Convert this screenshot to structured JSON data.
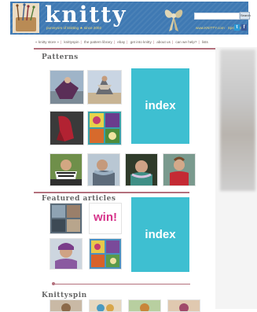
{
  "header": {
    "logo_text": "knitty",
    "tagline": "purveyors of knitting ★ since 2002",
    "search_button": "Search",
    "promo": "www.KNITTY.com · Spring 2014",
    "social_twitter": "t",
    "social_facebook": "f"
  },
  "nav": {
    "items": [
      "« knitty store »",
      "knittyspin",
      "the pattern library",
      "ebay",
      "get into knitty",
      "about us",
      "can we help?",
      "lists"
    ]
  },
  "patterns": {
    "title": "Patterns",
    "captions": [
      "",
      "",
      "",
      "",
      "",
      "",
      "",
      ""
    ],
    "index_label": "index"
  },
  "featured": {
    "title": "Featured articles",
    "win_label": "win!",
    "index_label": "index",
    "captions": [
      "",
      "",
      "",
      ""
    ]
  },
  "knittyspin": {
    "title": "Knittyspin"
  },
  "colors": {
    "header_blue": "#3f79b3",
    "accent_cyan": "#3ebfd1",
    "rule_rose": "#b3707c",
    "win_magenta": "#d6338a"
  }
}
